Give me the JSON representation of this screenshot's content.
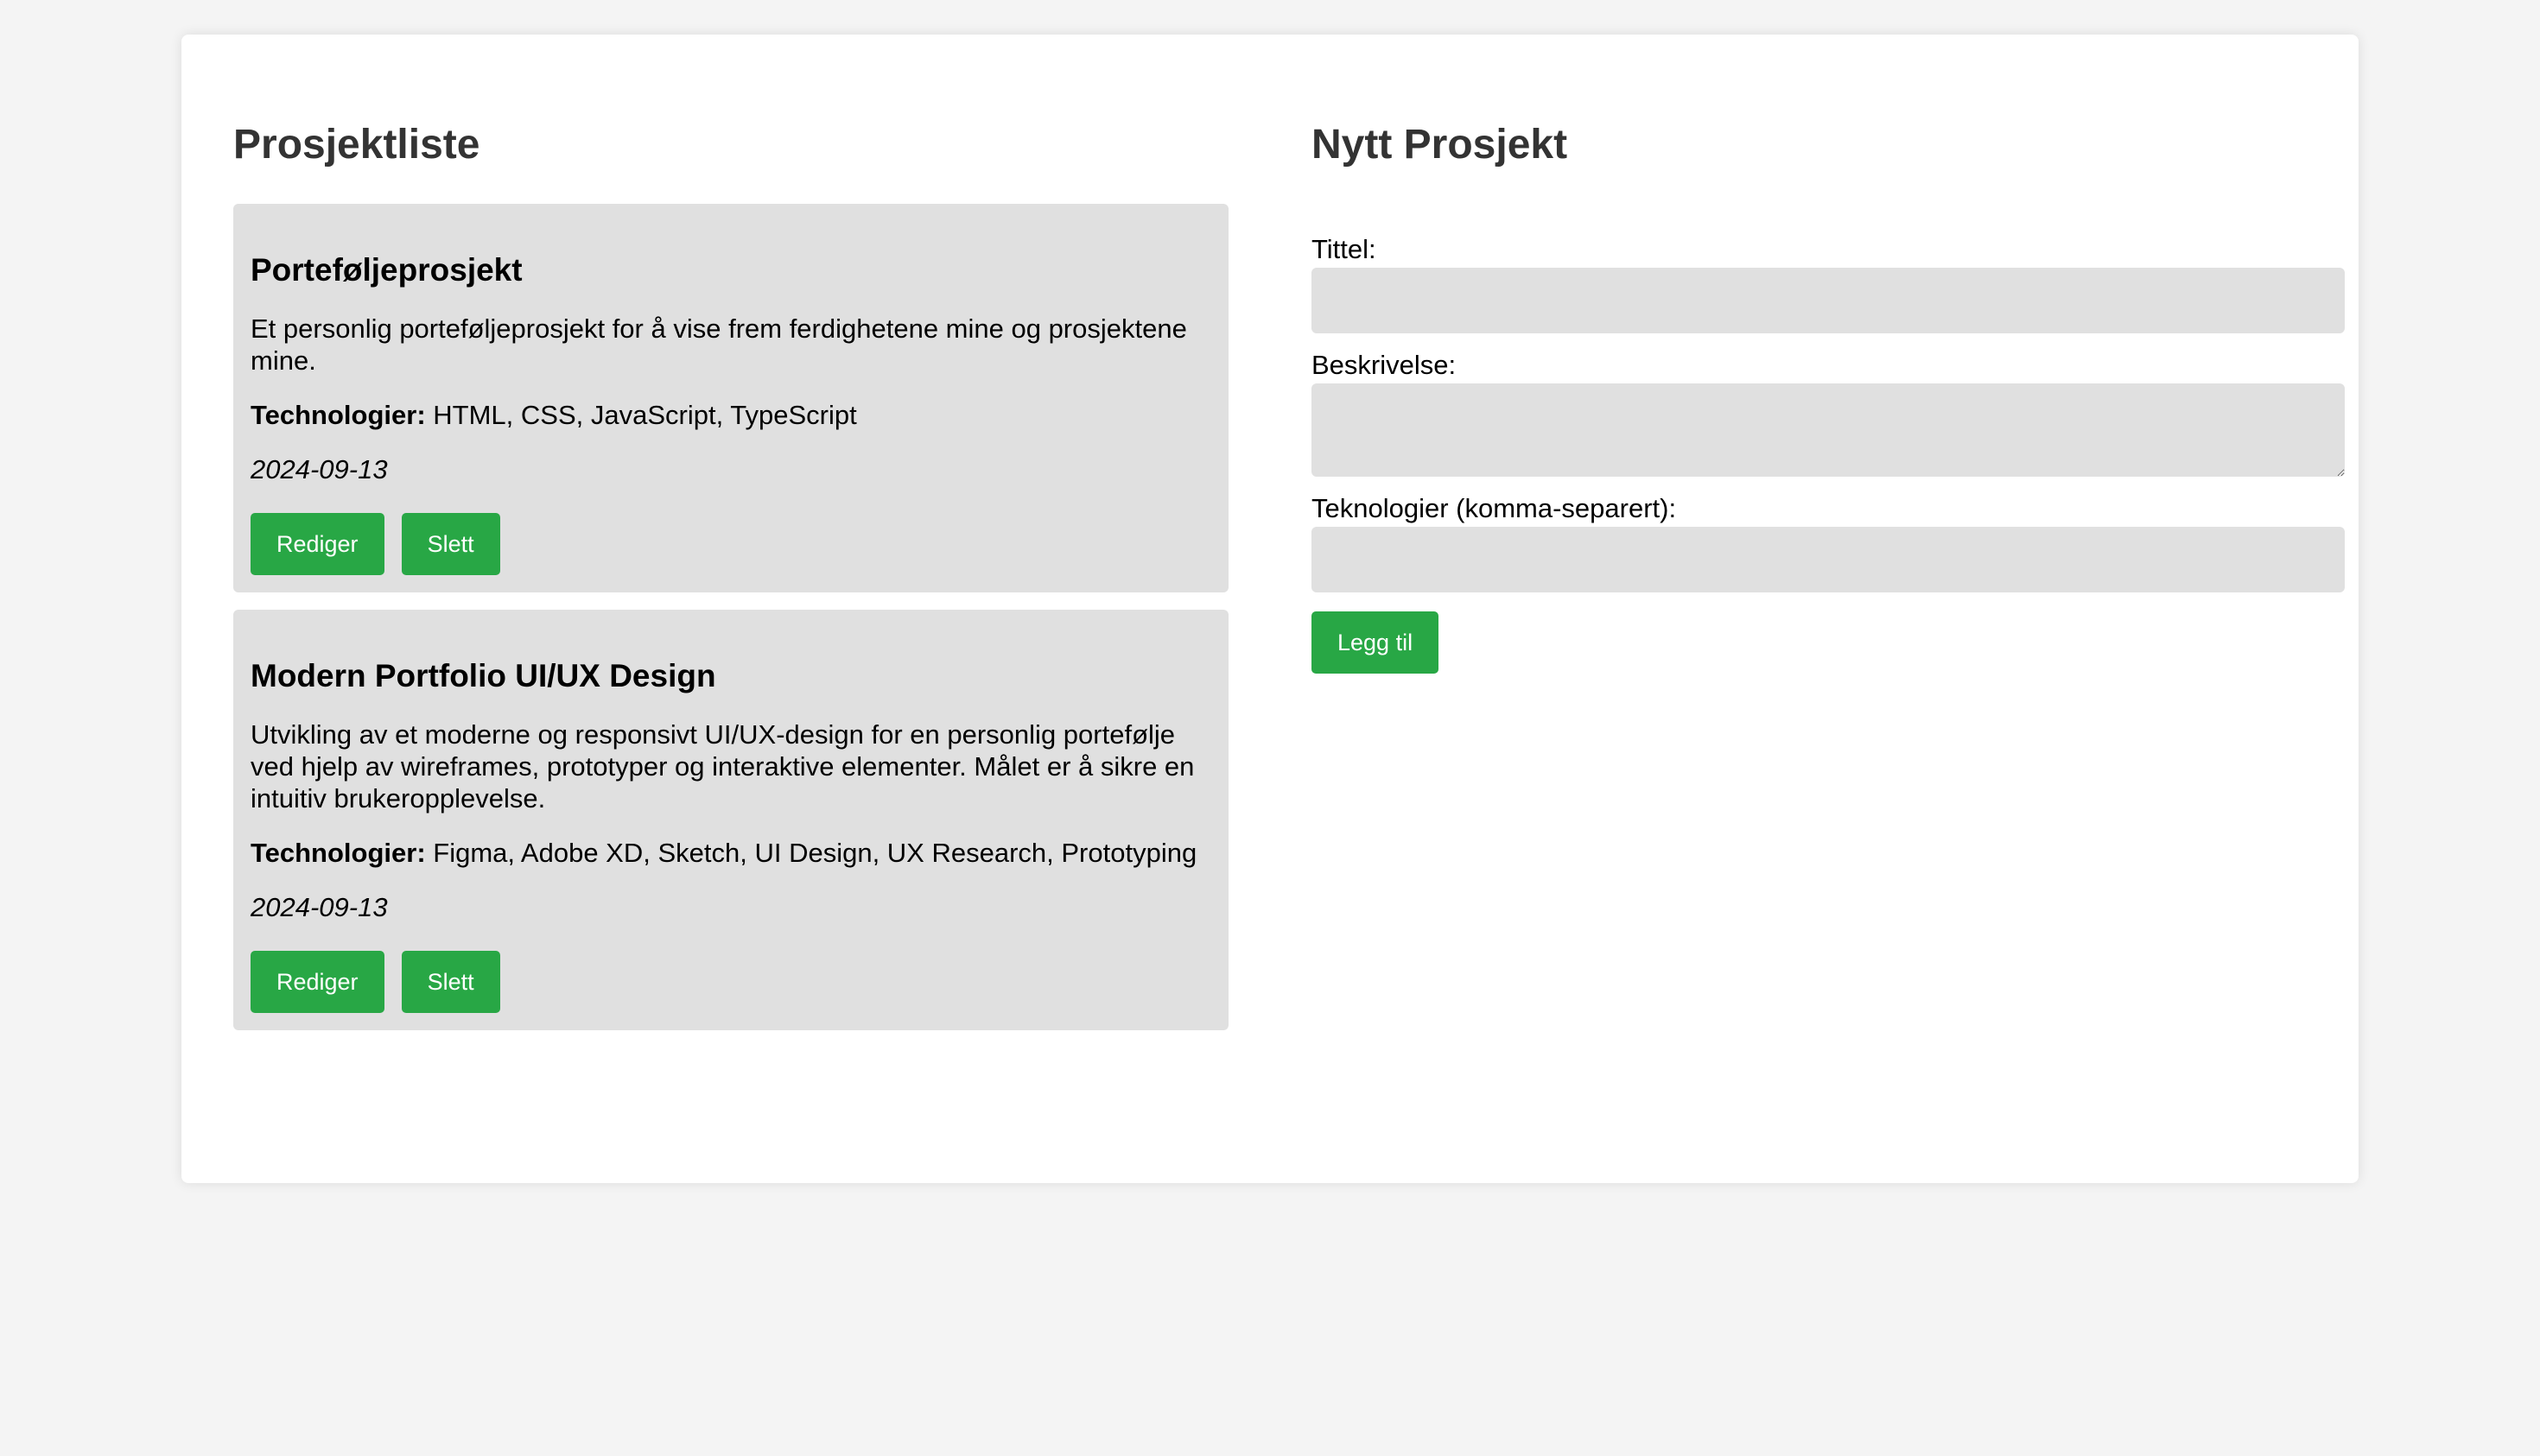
{
  "project_list": {
    "heading": "Prosjektliste",
    "tech_prefix": "Technologier:",
    "projects": [
      {
        "title": "Porteføljeprosjekt",
        "description": "Et personlig porteføljeprosjekt for å vise frem ferdighetene mine og prosjektene mine.",
        "technologies": "HTML, CSS, JavaScript, TypeScript",
        "date": "2024-09-13",
        "edit_label": "Rediger",
        "delete_label": "Slett"
      },
      {
        "title": "Modern Portfolio UI/UX Design",
        "description": "Utvikling av et moderne og responsivt UI/UX-design for en personlig portefølje ved hjelp av wireframes, prototyper og interaktive elementer. Målet er å sikre en intuitiv brukeropplevelse.",
        "technologies": "Figma, Adobe XD, Sketch, UI Design, UX Research, Prototyping",
        "date": "2024-09-13",
        "edit_label": "Rediger",
        "delete_label": "Slett"
      }
    ]
  },
  "new_project": {
    "heading": "Nytt Prosjekt",
    "title_label": "Tittel:",
    "title_value": "",
    "description_label": "Beskrivelse:",
    "description_value": "",
    "technologies_label": "Teknologier (komma-separert):",
    "technologies_value": "",
    "submit_label": "Legg til"
  },
  "colors": {
    "page_background": "#f4f4f4",
    "card_background": "#e0e0e0",
    "button_green": "#28a745",
    "heading_text": "#333333"
  }
}
